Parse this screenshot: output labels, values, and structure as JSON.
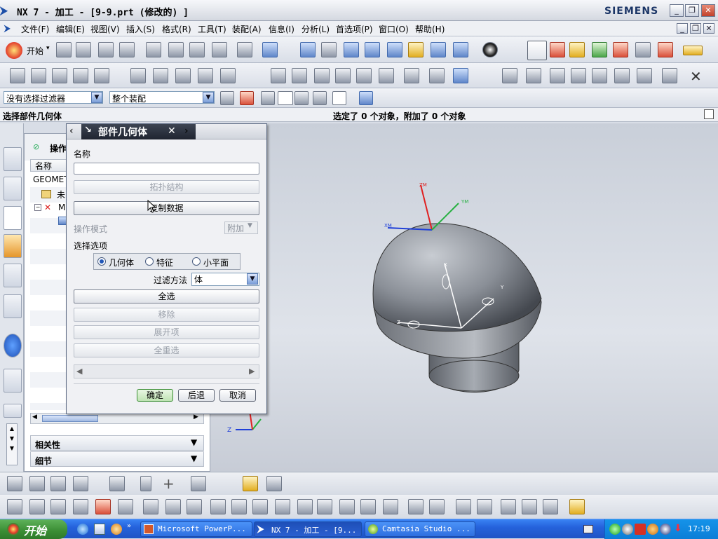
{
  "window": {
    "title": "NX 7 - 加工 - [9-9.prt  (修改的) ]",
    "brand": "SIEMENS"
  },
  "menu": [
    "文件(F)",
    "编辑(E)",
    "视图(V)",
    "插入(S)",
    "格式(R)",
    "工具(T)",
    "装配(A)",
    "信息(I)",
    "分析(L)",
    "首选项(P)",
    "窗口(O)",
    "帮助(H)"
  ],
  "toolbar1": {
    "start_label": "开始"
  },
  "filters": {
    "selection_filter": "没有选择过滤器",
    "assembly_scope": "整个装配"
  },
  "cue": {
    "left": "选择部件几何体",
    "right": "选定了 0 个对象，附加了 0 个对象"
  },
  "navigator": {
    "header": "操作",
    "column": "名称",
    "items": [
      "GEOMET",
      "未",
      "M"
    ],
    "sections": [
      "相关性",
      "细节"
    ]
  },
  "dialog": {
    "title": "部件几何体",
    "name_label": "名称",
    "name_value": "",
    "topology_button": "拓扑结构",
    "copy_data_button": "复制数据",
    "operation_mode_label": "操作模式",
    "operation_mode_value": "附加",
    "selection_options_label": "选择选项",
    "radio_options": [
      "几何体",
      "特征",
      "小平面"
    ],
    "radio_selected": "几何体",
    "filter_label": "过滤方法",
    "filter_value": "体",
    "select_all": "全选",
    "remove": "移除",
    "expand": "展开项",
    "reselect_all": "全重选",
    "ok": "确定",
    "back": "后退",
    "cancel": "取消"
  },
  "viewport": {
    "wcs_labels": [
      "ZM",
      "XM",
      "YM"
    ],
    "mcs_labels": [
      "X",
      "Y",
      "Z"
    ],
    "triad_label": "Z"
  },
  "taskbar": {
    "start": "开始",
    "tasks": [
      "Microsoft PowerP...",
      "NX 7 - 加工 - [9...",
      "Camtasia Studio ..."
    ],
    "clock": "17:19"
  },
  "colors": {
    "titlebar": "#d4d8e0",
    "dialog_title": "#2b313d",
    "taskbar": "#2563dc",
    "ok_accent": "#3a8d34"
  }
}
